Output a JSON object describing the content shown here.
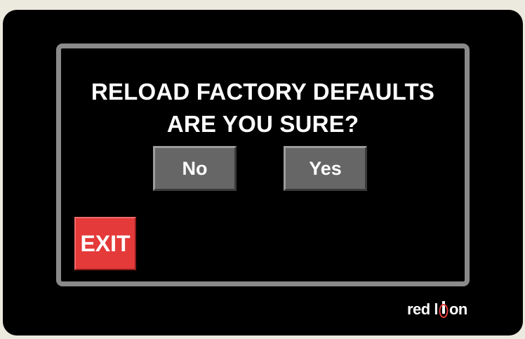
{
  "dialog": {
    "title_line1": "RELOAD FACTORY DEFAULTS",
    "title_line2": "ARE YOU SURE?"
  },
  "buttons": {
    "no_label": "No",
    "yes_label": "Yes",
    "exit_label": "EXIT"
  },
  "branding": {
    "logo_text": "red lion",
    "logo_text_left": "red l",
    "logo_text_right": "on",
    "accent_color": "#e43a3a"
  },
  "colors": {
    "background": "#000000",
    "frame": "#8a8a8a",
    "button": "#666666",
    "exit_button": "#e43a3a",
    "text": "#ffffff"
  }
}
